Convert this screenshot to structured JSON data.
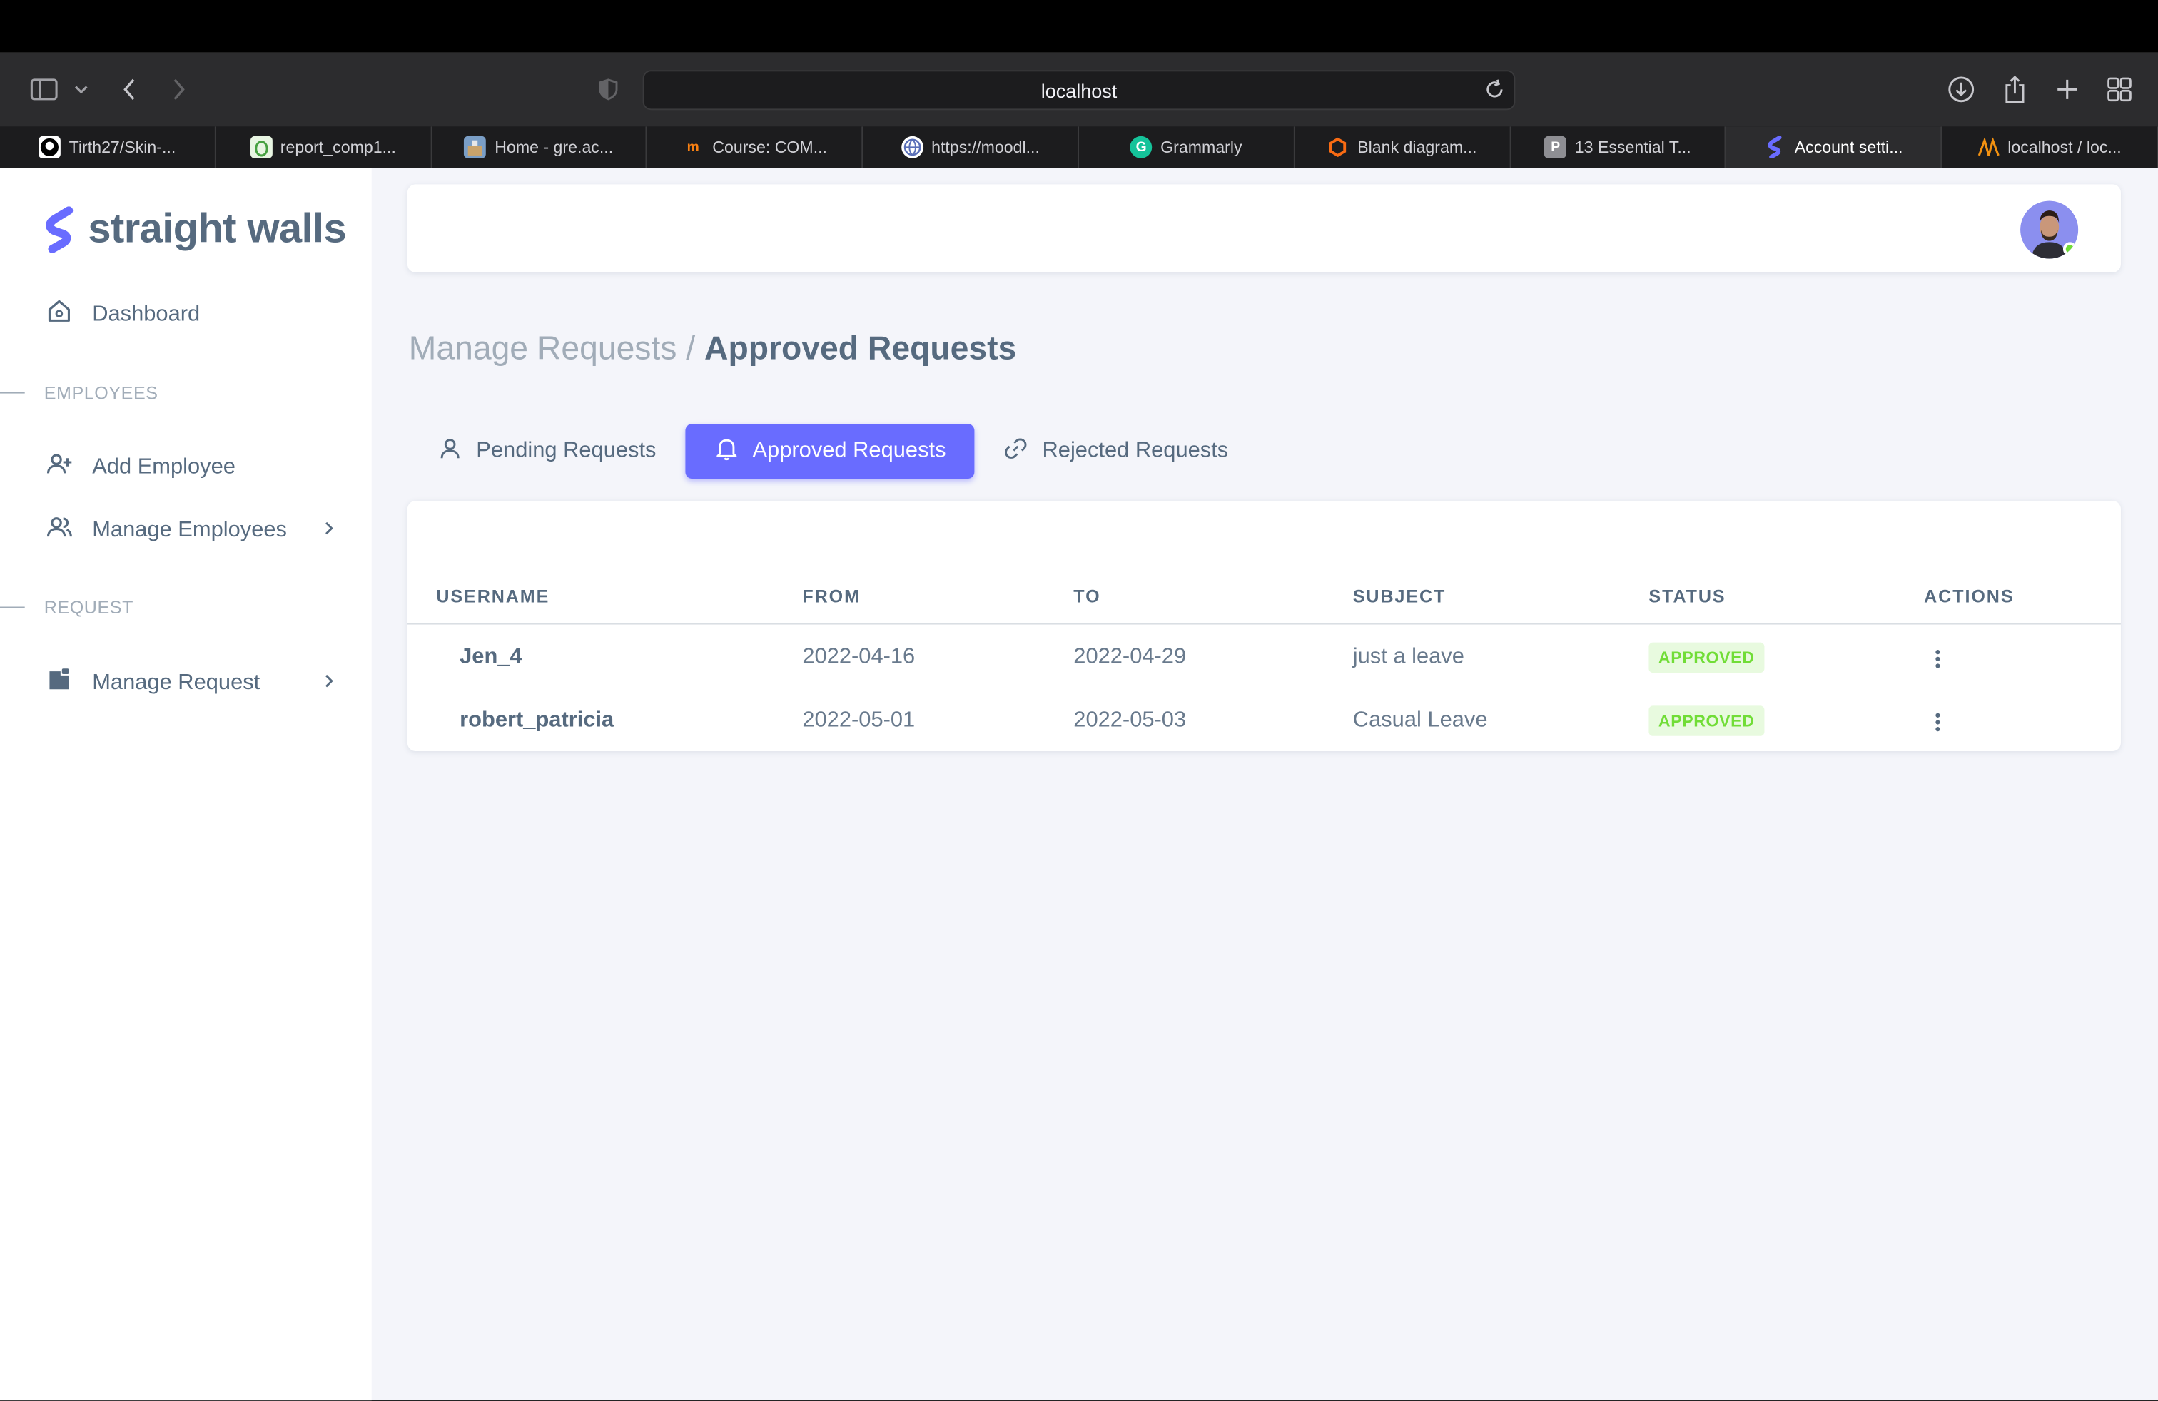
{
  "browser": {
    "address": "localhost",
    "tabs": [
      {
        "label": "Tirth27/Skin-...",
        "icon": "github-icon",
        "active": false
      },
      {
        "label": "report_comp1...",
        "icon": "overleaf-icon",
        "active": false
      },
      {
        "label": "Home - gre.ac...",
        "icon": "greenwich-icon",
        "active": false
      },
      {
        "label": "Course: COM...",
        "icon": "moodle-icon",
        "active": false
      },
      {
        "label": "https://moodl...",
        "icon": "globe-icon",
        "active": false
      },
      {
        "label": "Grammarly",
        "icon": "grammarly-icon",
        "active": false
      },
      {
        "label": "Blank diagram...",
        "icon": "lucidchart-icon",
        "active": false
      },
      {
        "label": "13 Essential T...",
        "icon": "p-icon",
        "active": false
      },
      {
        "label": "Account setti...",
        "icon": "straight-walls-icon",
        "active": true
      },
      {
        "label": "localhost / loc...",
        "icon": "phpmyadmin-icon",
        "active": false
      }
    ]
  },
  "sidebar": {
    "brand": "straight walls",
    "dashboard": "Dashboard",
    "section_employees": "EMPLOYEES",
    "add_employee": "Add Employee",
    "manage_employees": "Manage Employees",
    "section_request": "REQUEST",
    "manage_request": "Manage Request"
  },
  "breadcrumb": {
    "parent": "Manage Requests /",
    "current": "Approved Requests"
  },
  "tabs": {
    "pending": "Pending Requests",
    "approved": "Approved Requests",
    "rejected": "Rejected Requests"
  },
  "table": {
    "headers": [
      "USERNAME",
      "FROM",
      "TO",
      "SUBJECT",
      "STATUS",
      "ACTIONS"
    ],
    "rows": [
      {
        "username": "Jen_4",
        "from": "2022-04-16",
        "to": "2022-04-29",
        "subject": "just a leave",
        "status": "APPROVED"
      },
      {
        "username": "robert_patricia",
        "from": "2022-05-01",
        "to": "2022-05-03",
        "subject": "Casual Leave",
        "status": "APPROVED"
      }
    ]
  },
  "colors": {
    "accent": "#696cff",
    "status_success": "#71dd37",
    "text": "#566a7f"
  }
}
